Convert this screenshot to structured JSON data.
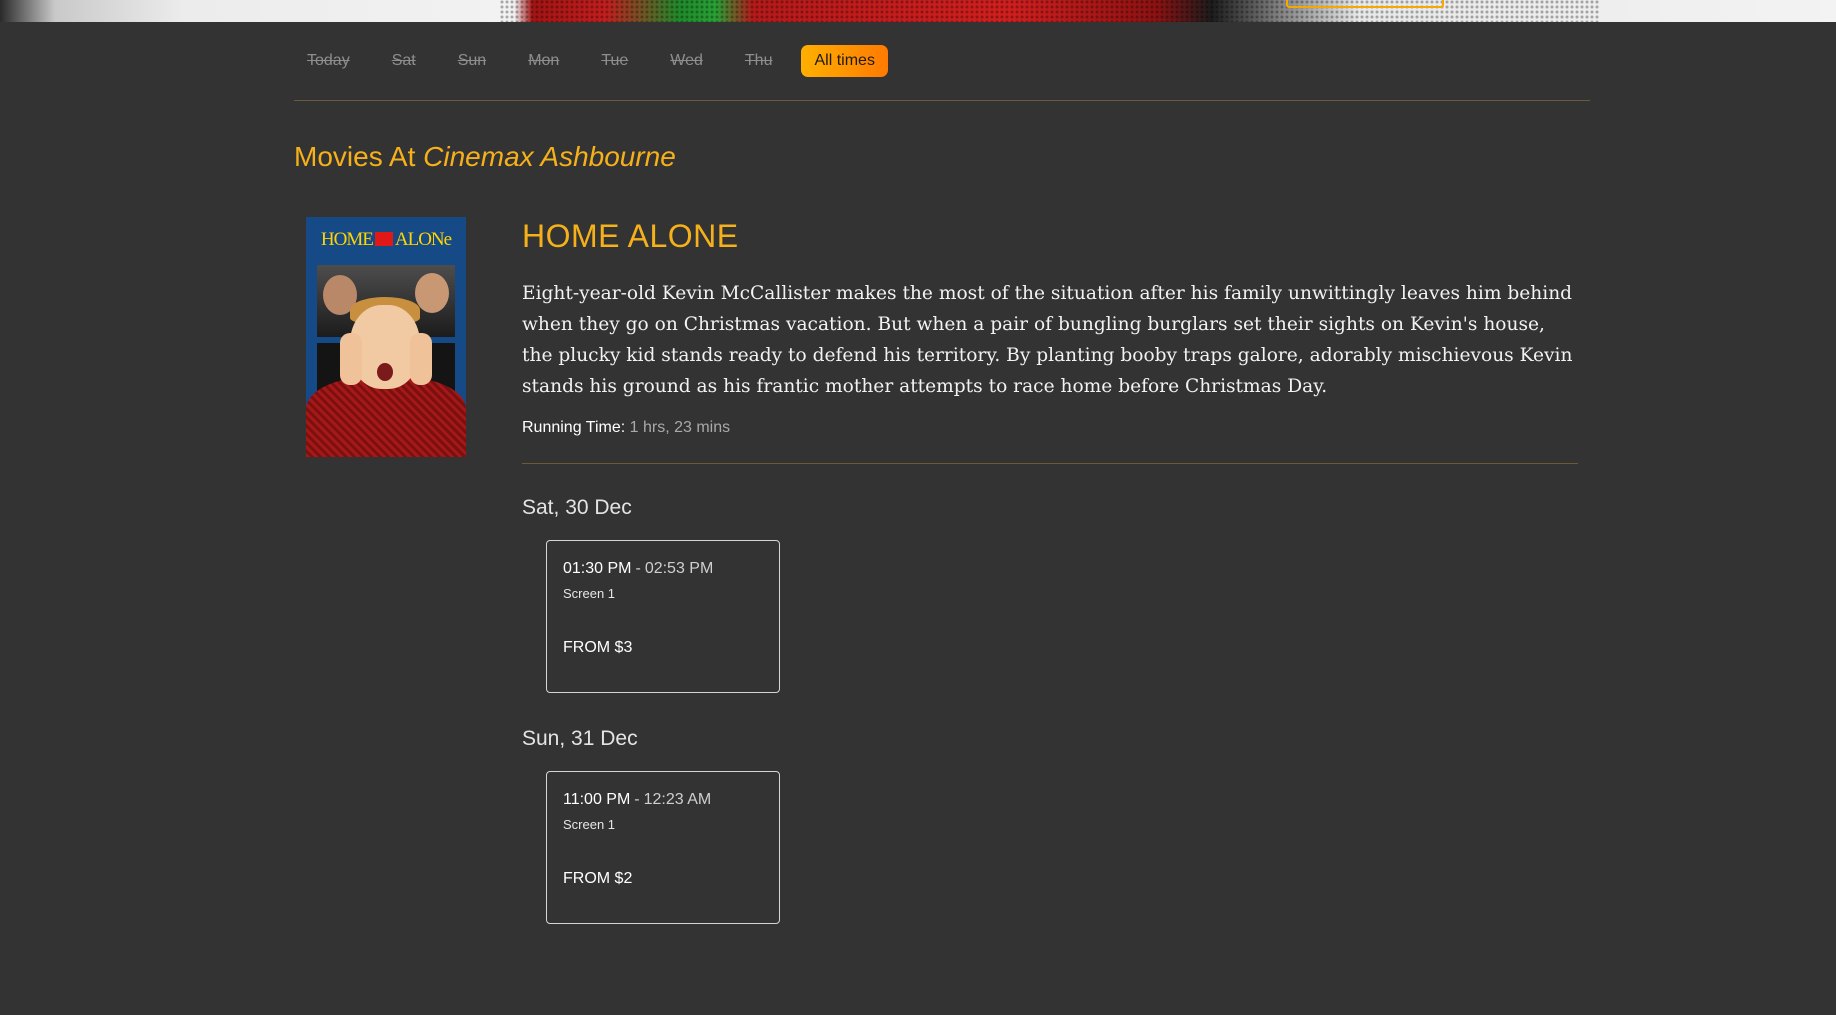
{
  "day_tabs": [
    {
      "label": "Today"
    },
    {
      "label": "Sat"
    },
    {
      "label": "Sun"
    },
    {
      "label": "Mon"
    },
    {
      "label": "Tue"
    },
    {
      "label": "Wed"
    },
    {
      "label": "Thu"
    },
    {
      "label": "All times"
    }
  ],
  "active_tab": "All times",
  "page_title": {
    "prefix": "Movies At",
    "venue": "Cinemax Ashbourne"
  },
  "movie": {
    "poster_logo_left": "HOME",
    "poster_logo_right": "ALONe",
    "title": "HOME ALONE",
    "synopsis": "Eight-year-old Kevin McCallister makes the most of the situation after his family unwittingly leaves him behind when they go on Christmas vacation. But when a pair of bungling burglars set their sights on Kevin's house, the plucky kid stands ready to defend his territory. By planting booby traps galore, adorably mischievous Kevin stands his ground as his frantic mother attempts to race home before Christmas Day.",
    "runtime_label": "Running Time:",
    "runtime_value": "1 hrs, 23 mins"
  },
  "showtimes": [
    {
      "day": "Sat, 30 Dec",
      "start": "01:30 PM",
      "separator": "-",
      "end": "02:53 PM",
      "screen": "Screen 1",
      "price": "FROM $3"
    },
    {
      "day": "Sun, 31 Dec",
      "start": "11:00 PM",
      "separator": "-",
      "end": "12:23 AM",
      "screen": "Screen 1",
      "price": "FROM $2"
    }
  ],
  "colors": {
    "background": "#333333",
    "accent": "#f6b11a",
    "active_tab_gradient_start": "#ffb000",
    "active_tab_gradient_end": "#ff7a00",
    "divider": "#6b5a3c"
  }
}
